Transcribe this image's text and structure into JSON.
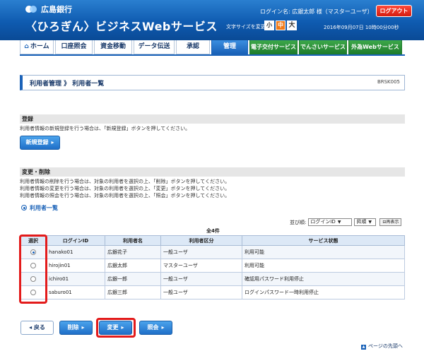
{
  "header": {
    "bank_name": "広島銀行",
    "service_name": "〈ひろぎん〉ビジネスWebサービス",
    "login_info": "ログイン名: 広銀太郎 様（マスターユーザ）",
    "logout_label": "ログアウト",
    "fontsize_label": "文字サイズを変更",
    "fontsize_small": "小",
    "fontsize_mid": "中",
    "fontsize_large": "大",
    "datetime": "2016年09月07日 10時00分00秒"
  },
  "nav": {
    "tabs": [
      {
        "label": "ホーム"
      },
      {
        "label": "口座照会"
      },
      {
        "label": "資金移動"
      },
      {
        "label": "データ伝送"
      },
      {
        "label": "承認"
      },
      {
        "label": "管理"
      },
      {
        "label": "電子交付サービス"
      },
      {
        "label": "でんさいサービス"
      },
      {
        "label": "外為Webサービス"
      }
    ]
  },
  "page": {
    "title": "利用者管理 》 利用者一覧",
    "screen_id": "BRSK005"
  },
  "register": {
    "heading": "登録",
    "desc": "利用者情報の新規登録を行う場合は、「新規登録」ボタンを押してください。",
    "button": "新規登録"
  },
  "modify": {
    "heading": "変更・削除",
    "desc1": "利用者情報の削除を行う場合は、対象の利用者を選択の上、「削除」ボタンを押してください。",
    "desc2": "利用者情報の変更を行う場合は、対象の利用者を選択の上、「変更」ボタンを押してください。",
    "desc3": "利用者情報の照会を行う場合は、対象の利用者を選択の上、「照会」ボタンを押してください。"
  },
  "list": {
    "label": "利用者一覧",
    "sort_label": "並び順:",
    "sort_key": "ログインID",
    "sort_order": "昇順",
    "redisplay": "再表示",
    "total": "全4件",
    "headers": [
      "選択",
      "ログインID",
      "利用者名",
      "利用者区分",
      "サービス状態"
    ],
    "rows": [
      {
        "login_id": "hanako01",
        "name": "広銀花子",
        "type": "一般ユーザ",
        "status": "利用可能",
        "selected": true
      },
      {
        "login_id": "hirojin01",
        "name": "広銀太郎",
        "type": "マスターユーザ",
        "status": "利用可能",
        "selected": false
      },
      {
        "login_id": "ichiro01",
        "name": "広銀一郎",
        "type": "一般ユーザ",
        "status": "確認用パスワード利用停止",
        "selected": false
      },
      {
        "login_id": "saburo01",
        "name": "広銀三郎",
        "type": "一般ユーザ",
        "status": "ログインパスワード一時利用停止",
        "selected": false
      }
    ]
  },
  "buttons": {
    "back": "戻る",
    "delete": "削除",
    "modify": "変更",
    "inquire": "照会"
  },
  "footer": {
    "page_top": "ページの先頭へ"
  }
}
